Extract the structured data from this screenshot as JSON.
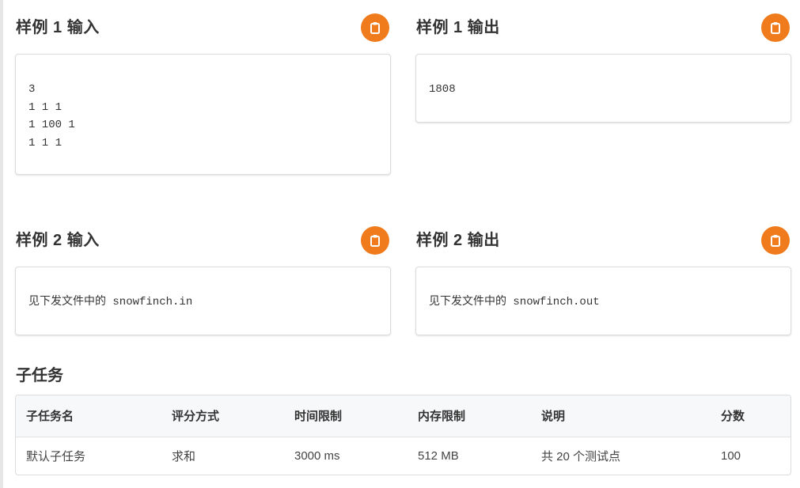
{
  "samples": [
    {
      "input_title": "样例 1 输入",
      "input_content": "3\n1 1 1\n1 100 1\n1 1 1",
      "output_title": "样例 1 输出",
      "output_content": "1808"
    },
    {
      "input_title": "样例 2 输入",
      "input_content": "见下发文件中的 snowfinch.in",
      "output_title": "样例 2 输出",
      "output_content": "见下发文件中的 snowfinch.out"
    }
  ],
  "copy_icon": "clipboard-icon",
  "accent_color": "#f07b1d",
  "subtasks": {
    "title": "子任务",
    "headers": [
      "子任务名",
      "评分方式",
      "时间限制",
      "内存限制",
      "说明",
      "分数"
    ],
    "rows": [
      [
        "默认子任务",
        "求和",
        "3000 ms",
        "512 MB",
        "共 20 个测试点",
        "100"
      ]
    ]
  }
}
